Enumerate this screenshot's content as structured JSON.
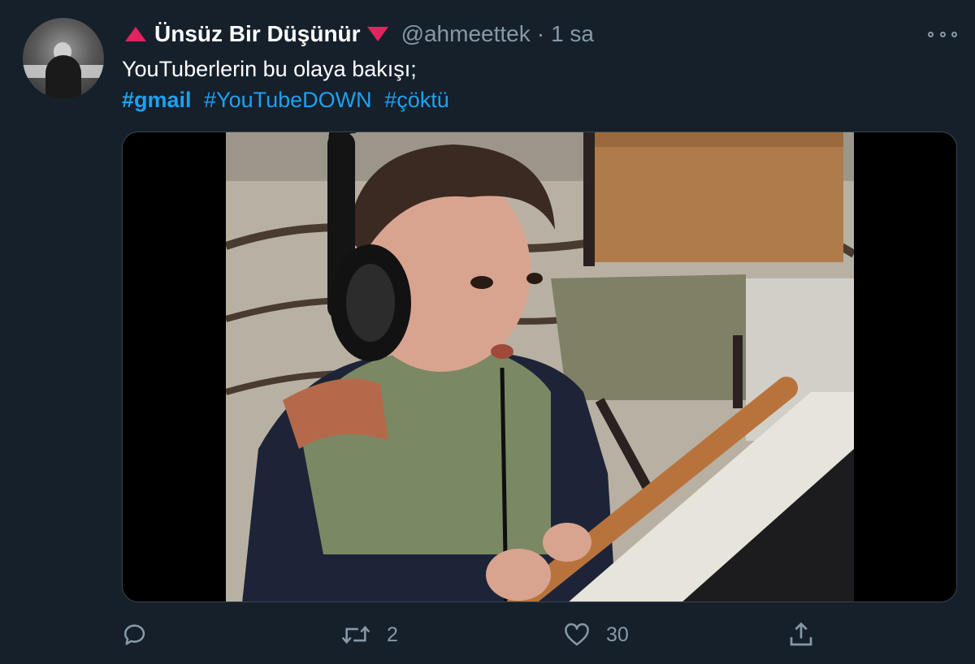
{
  "tweet": {
    "display_name": "Ünsüz Bir Düşünür",
    "handle": "@ahmeettek",
    "separator": "·",
    "time": "1 sa",
    "text": "YouTuberlerin bu olaya bakışı;",
    "hashtags": [
      "#gmail",
      "#YouTubeDOWN",
      "#çöktü"
    ],
    "media_description": "Photo of a young boy wearing headphones looking at a computer"
  },
  "actions": {
    "reply_count": "",
    "retweet_count": "2",
    "like_count": "30"
  },
  "icons": {
    "name_decoration_left": "red-triangle-up-icon",
    "name_decoration_right": "red-triangle-down-icon",
    "more": "ellipsis-icon",
    "reply": "speech-bubble-icon",
    "retweet": "retweet-arrows-icon",
    "like": "heart-icon",
    "share": "share-upload-icon"
  },
  "colors": {
    "background": "#15202b",
    "text_primary": "#ffffff",
    "text_secondary": "#8899a6",
    "link": "#1da1f2",
    "triangle": "#e0245e",
    "border": "#38444d"
  }
}
